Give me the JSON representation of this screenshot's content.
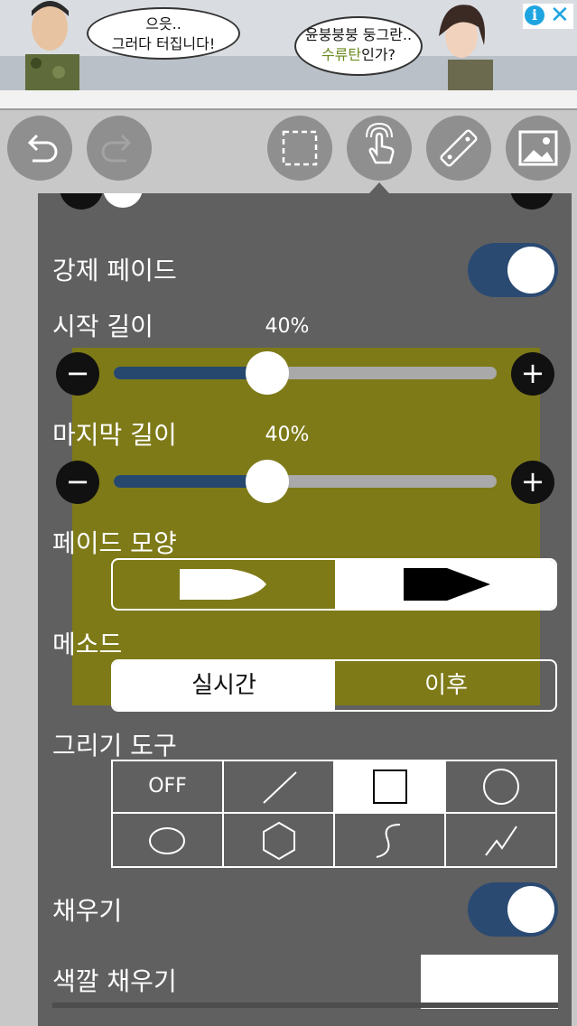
{
  "ad": {
    "bubble1_line1": "으읏..",
    "bubble1_line2": "그러다 터집니다!",
    "bubble2_line1": "윤붕붕붕 둥그란..",
    "bubble2_line2_hl": "수류탄",
    "bubble2_line2_rest": "인가?",
    "info_glyph": "i",
    "close_glyph": "✕"
  },
  "toolbar": {
    "buttons": [
      "undo-icon",
      "redo-icon",
      "selection-icon",
      "touch-icon",
      "ruler-icon",
      "image-icon"
    ]
  },
  "panel": {
    "forced_fade_label": "강제 페이드",
    "forced_fade_on": true,
    "start_length": {
      "label": "시작 길이",
      "value_text": "40%",
      "value": 0.4
    },
    "end_length": {
      "label": "마지막 길이",
      "value_text": "40%",
      "value": 0.4
    },
    "minus_glyph": "−",
    "plus_glyph": "+",
    "fade_shape_label": "페이드 모양",
    "fade_shape_selected": "pointed",
    "method_label": "메소드",
    "method_options": [
      "실시간",
      "이후"
    ],
    "method_selected": "실시간",
    "drawing_tool_label": "그리기 도구",
    "drawing_tools": [
      "OFF",
      "line",
      "rectangle",
      "circle",
      "ellipse",
      "polygon",
      "curve",
      "polyline"
    ],
    "drawing_tool_selected": "rectangle",
    "fill_label": "채우기",
    "fill_on": true,
    "fill_color_label": "색깔 채우기",
    "fill_color": "#ffffff"
  },
  "colors": {
    "accent": "#2b4a72",
    "panel_bg": "#606060",
    "track": "#a9a9a9",
    "ghost": "#7e7a18"
  }
}
